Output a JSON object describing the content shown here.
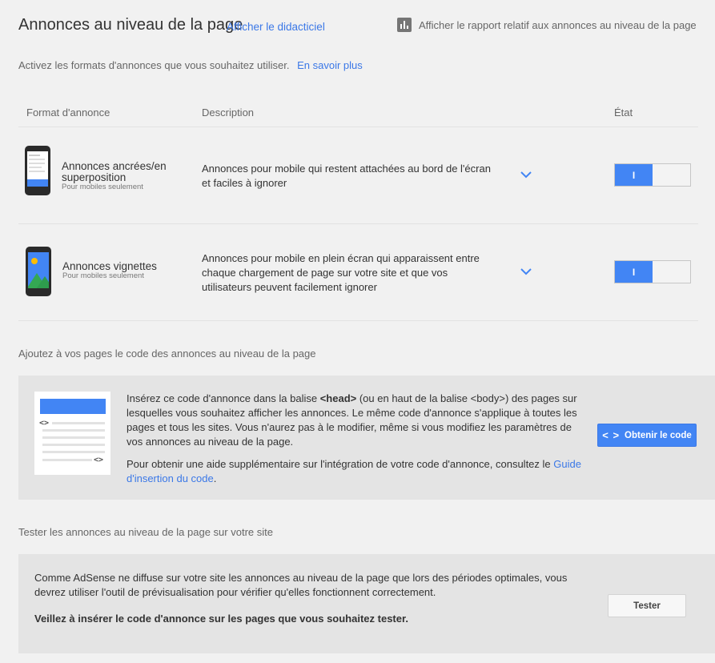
{
  "header": {
    "title": "Annonces au niveau de la page",
    "tutorial_link": "Afficher le didacticiel",
    "report_link": "Afficher le rapport relatif aux annonces au niveau de la page"
  },
  "intro": {
    "text": "Activez les formats d'annonces que vous souhaitez utiliser.",
    "learn_more": "En savoir plus"
  },
  "table": {
    "col_format": "Format d'annonce",
    "col_description": "Description",
    "col_state": "État",
    "rows": [
      {
        "name_line1": "Annonces ancrées/en",
        "name_line2": "superposition",
        "sub": "Pour mobiles seulement",
        "desc_line1": "Annonces pour mobile qui restent attachées au bord de l'écran",
        "desc_line2": "et faciles à ignorer",
        "toggle_label": "I"
      },
      {
        "name_line1": "Annonces vignettes",
        "sub": "Pour mobiles seulement",
        "desc_line1": "Annonces pour mobile en plein écran qui apparaissent entre",
        "desc_line2": "chaque chargement de page sur votre site et que vos",
        "desc_line3": "utilisateurs peuvent facilement ignorer",
        "toggle_label": "I"
      }
    ]
  },
  "code_section": {
    "title": "Ajoutez à vos pages le code des annonces au niveau de la page",
    "p1_before": "Insérez ce code d'annonce dans la balise ",
    "p1_bold": "<head>",
    "p1_after": " (ou en haut de la balise <body>) des pages sur lesquelles vous souhaitez afficher les annonces. Le même code d'annonce s'applique à toutes les pages et tous les sites. Vous n'aurez pas à le modifier, même si vous modifiez les paramètres de vos annonces au niveau de la page.",
    "p2_before": "Pour obtenir une aide supplémentaire sur l'intégration de votre code d'annonce, consultez le ",
    "p2_link": "Guide d'insertion du code",
    "p2_after": ".",
    "button_icon": "< >",
    "button_label": "Obtenir le code",
    "snippet_icon_top": "<>",
    "snippet_icon_bottom": "<>"
  },
  "test_section": {
    "title": "Tester les annonces au niveau de la page sur votre site",
    "p1": "Comme AdSense ne diffuse sur votre site les annonces au niveau de la page que lors des périodes optimales, vous devrez utiliser l'outil de prévisualisation pour vérifier qu'elles fonctionnent correctement.",
    "p2": "Veillez à insérer le code d'annonce sur les pages que vous souhaitez tester.",
    "button_label": "Tester"
  },
  "colors": {
    "accent": "#4285f4",
    "link": "#3b78e7",
    "background": "#f1f1f1",
    "panel": "#e4e4e4"
  }
}
